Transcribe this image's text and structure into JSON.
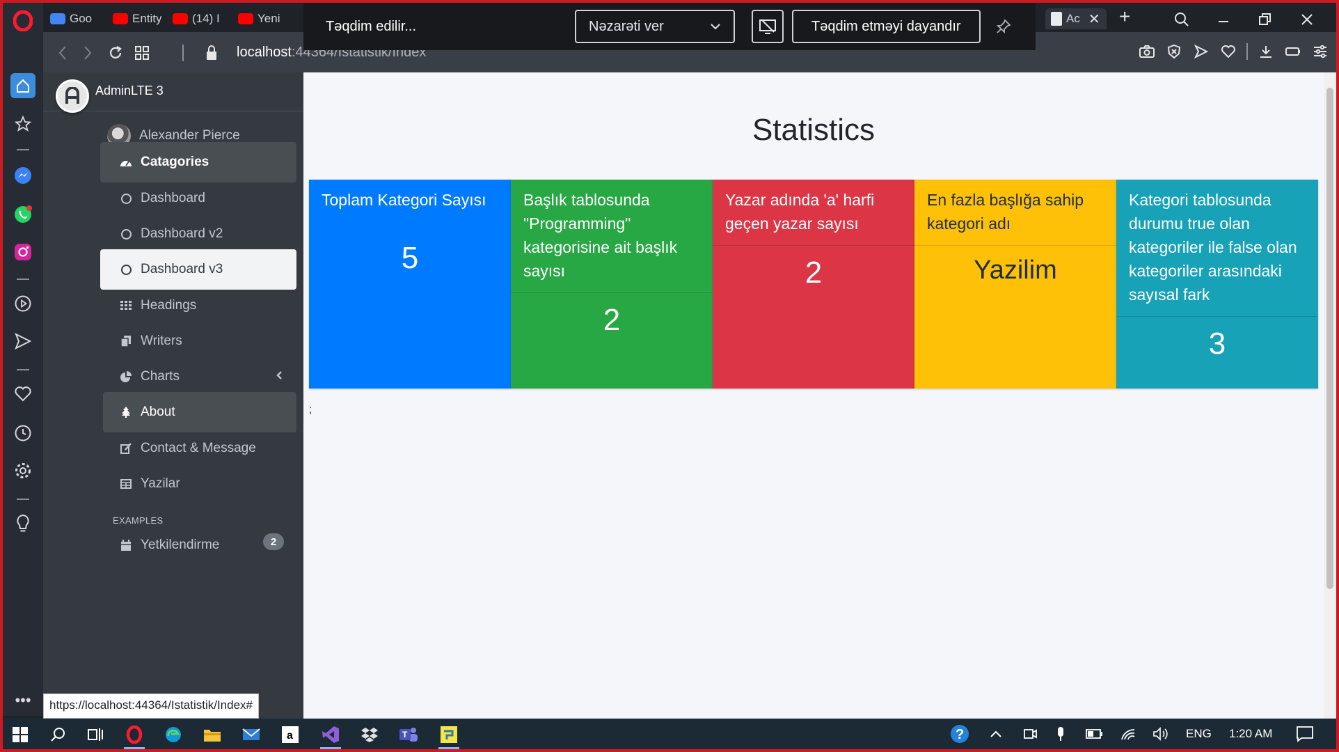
{
  "browser": {
    "tabs": [
      {
        "label": "Goo",
        "color": "#4285f4"
      },
      {
        "label": "Entity",
        "color": "#ff0000"
      },
      {
        "label": "(14) I",
        "color": "#ff0000"
      },
      {
        "label": "Yeni",
        "color": "#ff0000"
      },
      {
        "label": "Ac",
        "color": "#e8eaed"
      }
    ],
    "address": {
      "host": "localhost",
      "rest": ":44364/Istatistik/Index"
    },
    "status_url": "https://localhost:44364/Istatistik/Index#"
  },
  "presenting": {
    "status": "Təqdim edilir...",
    "control_select": "Nəzarəti ver",
    "stop_label": "Təqdim etməyi dayandır"
  },
  "sidebar": {
    "brand": "AdminLTE 3",
    "user": "Alexander Pierce",
    "items": [
      {
        "label": "Catagories"
      },
      {
        "label": "Dashboard"
      },
      {
        "label": "Dashboard v2"
      },
      {
        "label": "Dashboard v3"
      },
      {
        "label": "Headings"
      },
      {
        "label": "Writers"
      },
      {
        "label": "Charts"
      },
      {
        "label": "About"
      },
      {
        "label": "Contact & Message"
      },
      {
        "label": "Yazilar"
      }
    ],
    "section_header": "EXAMPLES",
    "examples_item": {
      "label": "Yetkilendirme",
      "badge": "2"
    }
  },
  "main": {
    "title": "Statistics",
    "cards": [
      {
        "label": "Toplam Kategori Sayısı",
        "value": "5",
        "color": "#007bff"
      },
      {
        "label": "Başlık tablosunda \"Programming\" kategorisine ait başlık sayısı",
        "value": "2",
        "color": "#28a745"
      },
      {
        "label": "Yazar adında 'a' harfi geçen yazar sayısı",
        "value": "2",
        "color": "#dc3545"
      },
      {
        "label": "En fazla başlığa sahip kategori adı",
        "value": "Yazilim",
        "color": "#ffc107"
      },
      {
        "label": "Kategori tablosunda durumu true olan kategoriler ile false olan kategoriler arasındaki sayısal fark",
        "value": "3",
        "color": "#17a2b8"
      }
    ],
    "stray_text": ";"
  },
  "taskbar": {
    "language": "ENG",
    "time": "1:20 AM"
  }
}
